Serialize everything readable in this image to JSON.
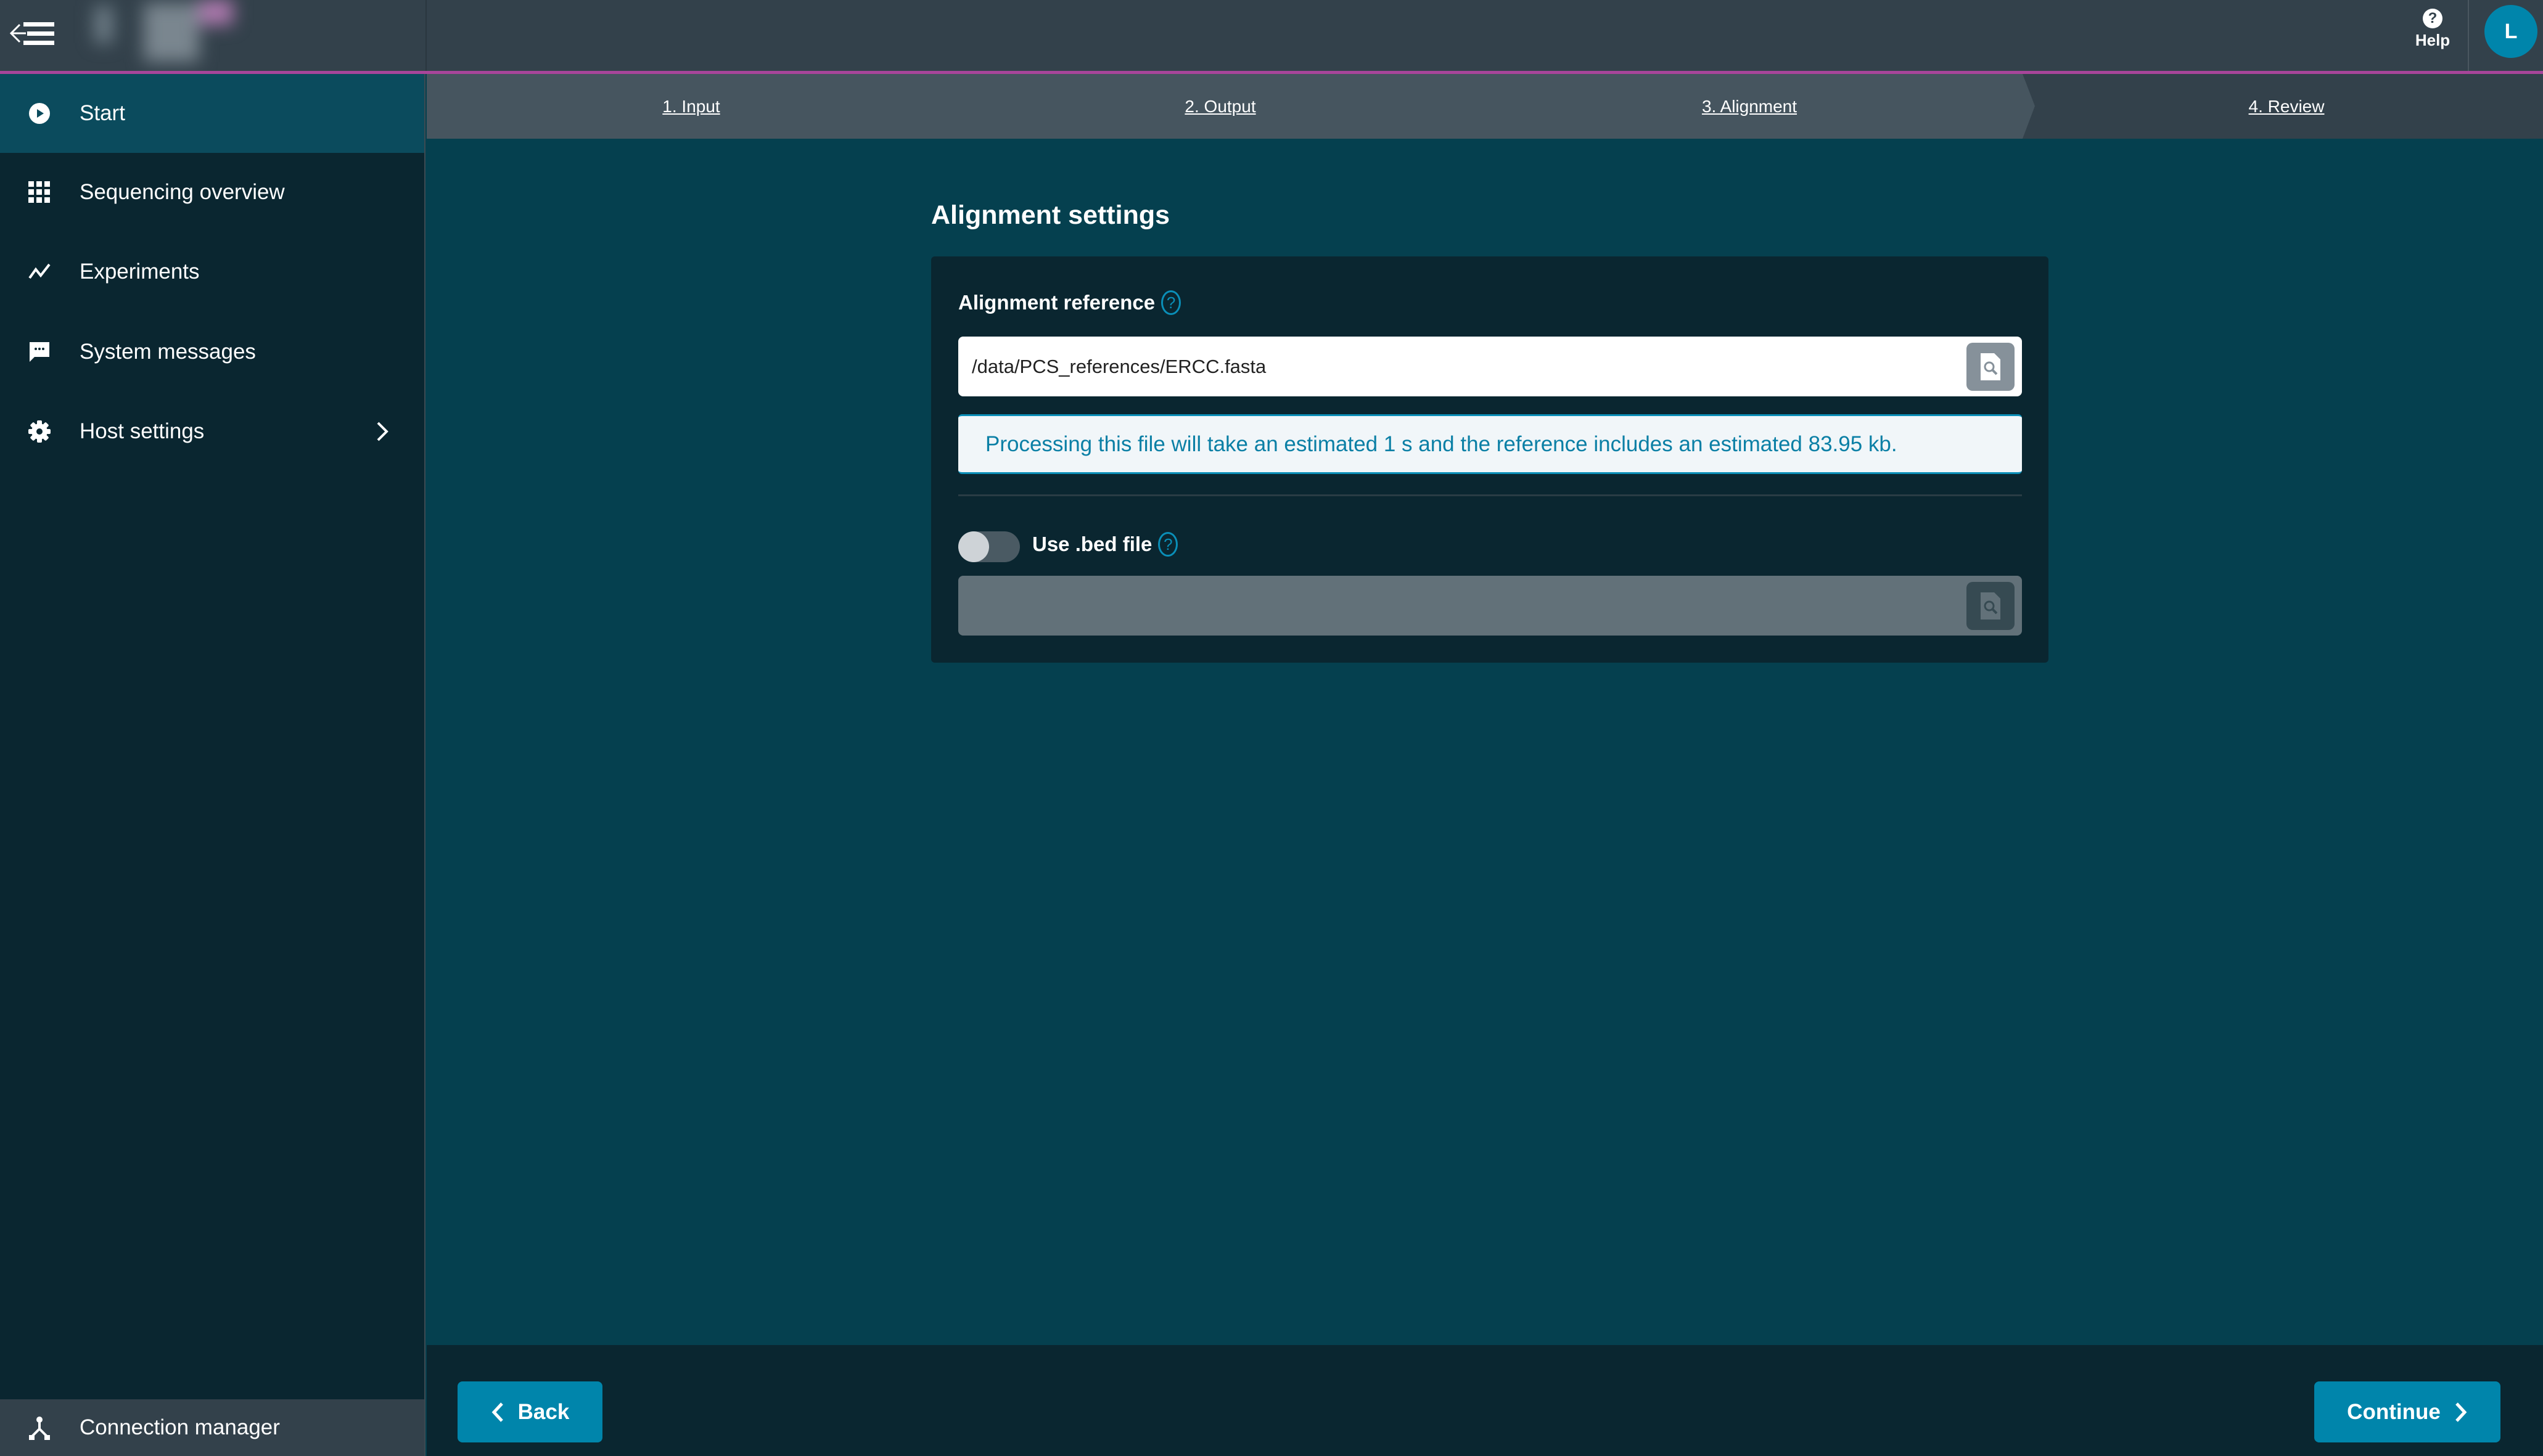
{
  "topbar": {
    "menu_icon": "collapse-menu-icon",
    "help_label": "Help",
    "help_icon": "question-circle-icon",
    "avatar_initial": "L",
    "accent_line_color": "#a8459a"
  },
  "sidebar": {
    "items": [
      {
        "label": "Start",
        "icon": "play-circle-icon",
        "active": true
      },
      {
        "label": "Sequencing overview",
        "icon": "grid-icon",
        "active": false
      },
      {
        "label": "Experiments",
        "icon": "trend-line-icon",
        "active": false
      },
      {
        "label": "System messages",
        "icon": "message-icon",
        "active": false
      },
      {
        "label": "Host settings",
        "icon": "gear-icon",
        "active": false,
        "has_submenu": true
      }
    ],
    "bottom_item": {
      "label": "Connection manager",
      "icon": "network-icon"
    }
  },
  "steps": [
    {
      "label": "1. Input",
      "state": "done"
    },
    {
      "label": "2. Output",
      "state": "done"
    },
    {
      "label": "3. Alignment",
      "state": "current"
    },
    {
      "label": "4. Review",
      "state": "upcoming"
    }
  ],
  "main": {
    "section_title": "Alignment settings",
    "alignment_reference": {
      "label": "Alignment reference",
      "value": "/data/PCS_references/ERCC.fasta",
      "browse_icon": "file-search-icon"
    },
    "info_message": "Processing this file will take an estimated 1 s and the reference includes an estimated 83.95 kb.",
    "bed_file": {
      "label": "Use .bed file",
      "enabled": false,
      "value": "",
      "browse_icon": "file-search-icon"
    }
  },
  "footer": {
    "back_label": "Back",
    "continue_label": "Continue"
  },
  "colors": {
    "primary": "#0085ab",
    "sidebar_bg": "#0a2630",
    "main_bg": "#05404f",
    "active_nav": "#0b4b5d"
  }
}
